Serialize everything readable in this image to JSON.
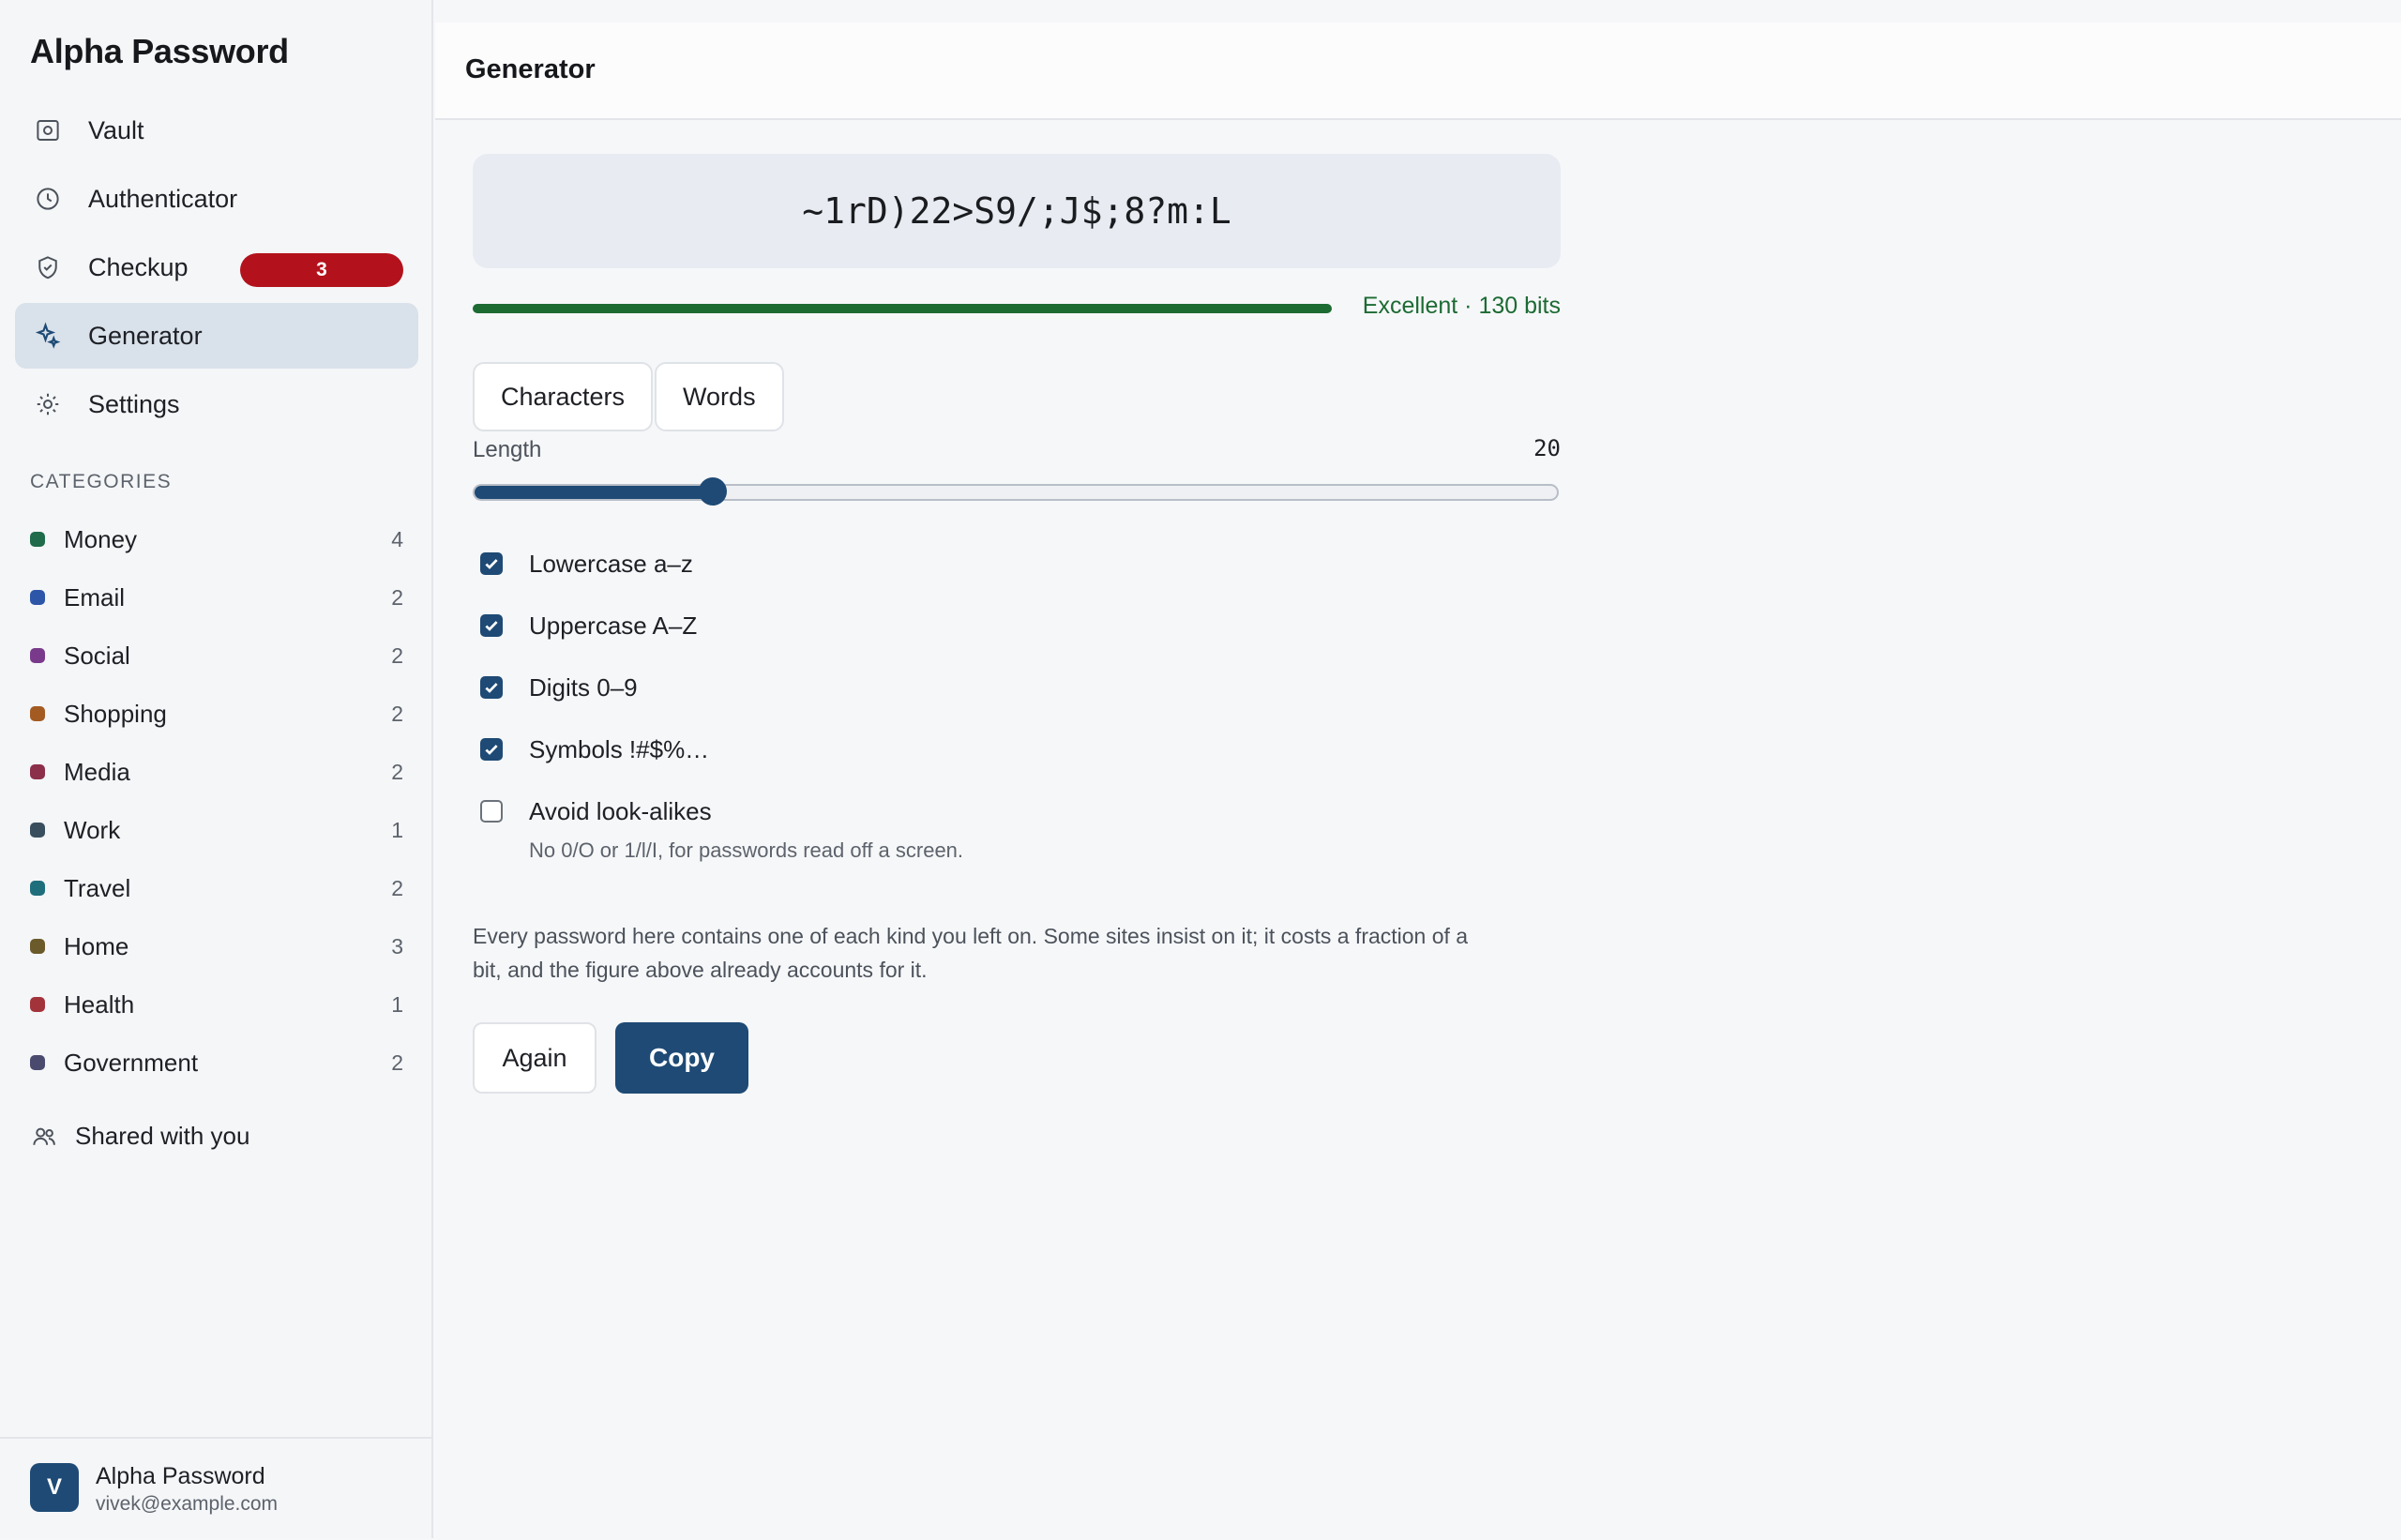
{
  "app": {
    "title": "Alpha Password"
  },
  "nav": {
    "items": [
      {
        "label": "Vault",
        "icon": "vault-icon"
      },
      {
        "label": "Authenticator",
        "icon": "clock-icon"
      },
      {
        "label": "Checkup",
        "icon": "shield-icon",
        "badge": "3"
      },
      {
        "label": "Generator",
        "icon": "sparkle-icon",
        "active": true
      },
      {
        "label": "Settings",
        "icon": "gear-icon"
      }
    ]
  },
  "categories": {
    "heading": "CATEGORIES",
    "items": [
      {
        "label": "Money",
        "count": "4",
        "color": "#1f6b4a"
      },
      {
        "label": "Email",
        "count": "2",
        "color": "#2d56a8"
      },
      {
        "label": "Social",
        "count": "2",
        "color": "#7a3a8c"
      },
      {
        "label": "Shopping",
        "count": "2",
        "color": "#a35b22"
      },
      {
        "label": "Media",
        "count": "2",
        "color": "#8c2f4a"
      },
      {
        "label": "Work",
        "count": "1",
        "color": "#3a4f5e"
      },
      {
        "label": "Travel",
        "count": "2",
        "color": "#1e6e7c"
      },
      {
        "label": "Home",
        "count": "3",
        "color": "#6b5a2a"
      },
      {
        "label": "Health",
        "count": "1",
        "color": "#a3333a"
      },
      {
        "label": "Government",
        "count": "2",
        "color": "#4a4a6e"
      }
    ]
  },
  "shared": {
    "label": "Shared with you"
  },
  "user": {
    "initial": "V",
    "name": "Alpha Password",
    "email": "vivek@example.com"
  },
  "header": {
    "title": "Generator"
  },
  "generator": {
    "password": "~1rD)22>S9/;J$;8?m:L",
    "strength_label": "Excellent · 130 bits",
    "strength_fraction": 1.0,
    "strength_color": "#1c6b33",
    "modes": [
      "Characters",
      "Words"
    ],
    "length_label": "Length",
    "length_value": "20",
    "length_fraction": 0.22,
    "options": [
      {
        "label": "Lowercase a–z",
        "checked": true
      },
      {
        "label": "Uppercase A–Z",
        "checked": true
      },
      {
        "label": "Digits 0–9",
        "checked": true
      },
      {
        "label": "Symbols !#$%…",
        "checked": true
      },
      {
        "label": "Avoid look-alikes",
        "checked": false
      }
    ],
    "avoid_hint": "No 0/O or 1/l/I, for passwords read off a screen.",
    "note": "Every password here contains one of each kind you left on. Some sites insist on it; it costs a fraction of a bit, and the figure above already accounts for it.",
    "again_label": "Again",
    "copy_label": "Copy",
    "accent": "#1e4a75"
  }
}
